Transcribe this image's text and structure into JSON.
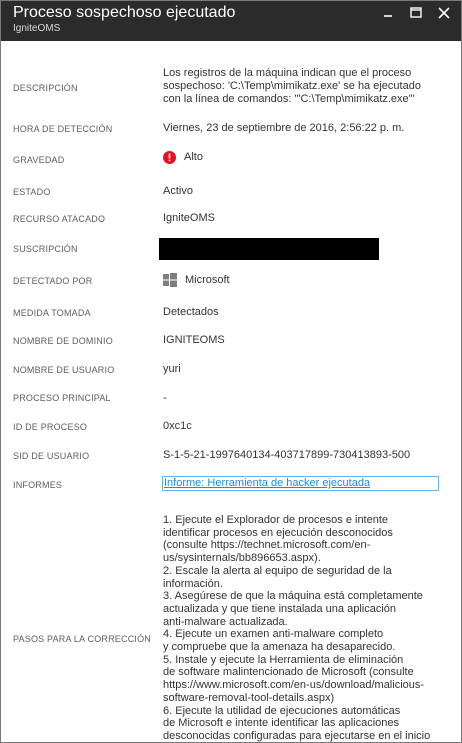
{
  "window": {
    "title": "Proceso sospechoso ejecutado",
    "subtitle": "IgniteOMS",
    "controls": [
      "pin-icon",
      "maximize-icon",
      "close-icon"
    ]
  },
  "fields": {
    "descripcion": {
      "label": "DESCRIPCIÓN",
      "value_lines": [
        "Los registros de la máquina indican que el proceso",
        "sospechoso: 'C:\\Temp\\mimikatz.exe' se ha ejecutado",
        "con la línea de comandos: '\"C:\\Temp\\mimikatz.exe\"'"
      ]
    },
    "hora": {
      "label": "HORA DE DETECCIÓN",
      "value": "Viernes, 23 de septiembre de 2016, 2:56:22 p. m."
    },
    "gravedad": {
      "label": "GRAVEDAD",
      "value": "Alto",
      "icon": "high-severity-icon",
      "color": "#e81123"
    },
    "estado": {
      "label": "ESTADO",
      "value": "Activo"
    },
    "recurso": {
      "label": "RECURSO ATACADO",
      "value": "IgniteOMS"
    },
    "suscripcion": {
      "label": "SUSCRIPCIÓN"
    },
    "detectado": {
      "label": "DETECTADO POR",
      "value": "Microsoft",
      "icon": "windows-logo-icon"
    },
    "medida": {
      "label": "MEDIDA TOMADA",
      "value": "Detectados"
    },
    "dominio": {
      "label": "NOMBRE DE DOMINIO",
      "value": "IGNITEOMS"
    },
    "usuario": {
      "label": "NOMBRE DE USUARIO",
      "value": "yuri"
    },
    "principal": {
      "label": "PROCESO PRINCIPAL",
      "value": "-"
    },
    "pid": {
      "label": "ID DE PROCESO",
      "value": "0xc1c"
    },
    "sid": {
      "label": "SID DE USUARIO",
      "value": "S-1-5-21-1997640134-403717899-730413893-500"
    },
    "informes": {
      "label": "INFORMES",
      "link": "Informe: Herramienta de hacker ejecutada"
    },
    "pasos": {
      "label": "PASOS PARA LA CORRECCIÓN",
      "lines": [
        "1. Ejecute el Explorador de procesos e intente",
        "identificar procesos en ejecución desconocidos",
        "(consulte https://technet.microsoft.com/en-",
        "us/sysinternals/bb896653.aspx).",
        "2. Escale la alerta al equipo de seguridad de la información.",
        "3. Asegúrese de que la máquina está completamente",
        "actualizada y que tiene instalada una aplicación",
        "anti-malware actualizada.",
        "4. Ejecute un examen anti-malware completo",
        "y compruebe que la amenaza ha desaparecido.",
        "5. Instale y ejecute la Herramienta de eliminación",
        "de software malintencionado de Microsoft (consulte",
        "https://www.microsoft.com/en-us/download/malicious-",
        "software-removal-tool-details.aspx)",
        "6. Ejecute la utilidad de ejecuciones automáticas",
        "de Microsoft e intente identificar las aplicaciones",
        "desconocidas configuradas para ejecutarse en el inicio"
      ]
    }
  }
}
